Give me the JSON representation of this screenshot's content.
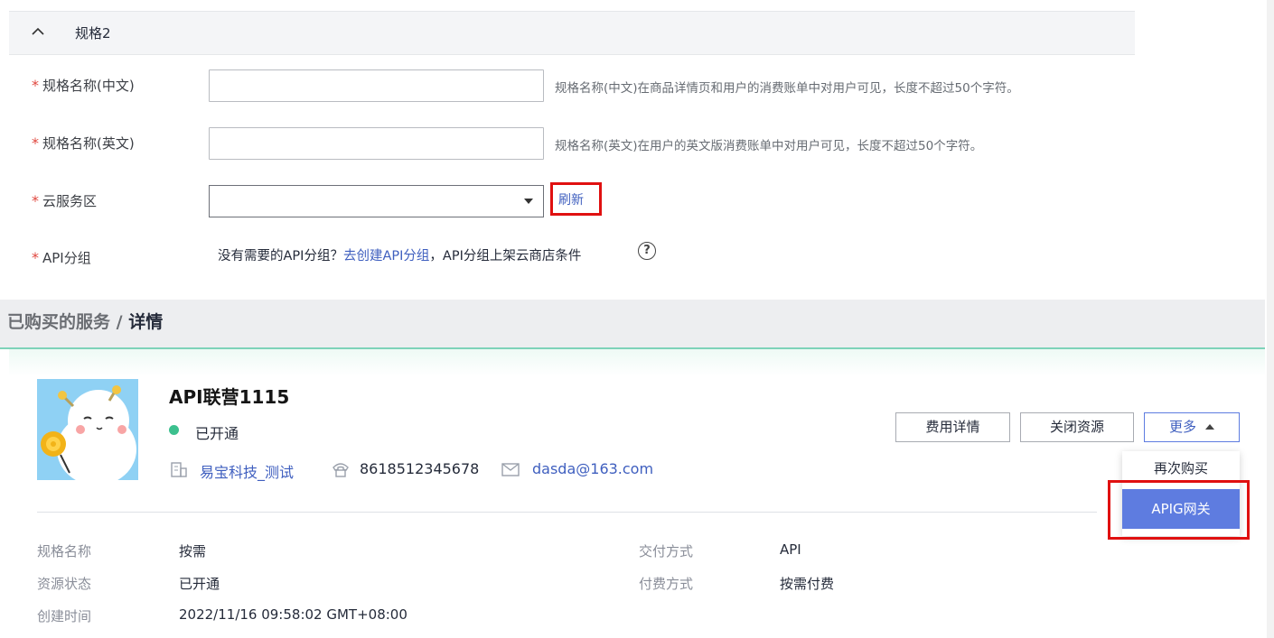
{
  "spec_section": {
    "title": "规格2",
    "fields": [
      {
        "label": "规格名称(中文)",
        "value": "",
        "hint": "规格名称(中文)在商品详情页和用户的消费账单中对用户可见，长度不超过50个字符。"
      },
      {
        "label": "规格名称(英文)",
        "value": "",
        "hint": "规格名称(英文)在用户的英文版消费账单中对用户可见，长度不超过50个字符。"
      }
    ],
    "region": {
      "label": "云服务区",
      "value": "",
      "refresh": "刷新"
    },
    "api_group": {
      "label": "API分组",
      "text_before": "没有需要的API分组？",
      "link": "去创建API分组",
      "text_after": "，API分组上架云商店条件",
      "help": "?"
    },
    "required_mark": "*"
  },
  "detail": {
    "breadcrumb_parent": "已购买的服务",
    "breadcrumb_sep": " / ",
    "breadcrumb_current": "详情",
    "service_name": "API联营1115",
    "status": "已开通",
    "company": "易宝科技_测试",
    "phone": "8618512345678",
    "email": "dasda@163.com",
    "buttons": {
      "fee_details": "费用详情",
      "close_resource": "关闭资源",
      "more": "更多"
    },
    "more_menu": [
      "再次购买",
      "APIG网关"
    ],
    "info": {
      "spec_name_label": "规格名称",
      "spec_name": "按需",
      "resource_status_label": "资源状态",
      "resource_status": "已开通",
      "created_label": "创建时间",
      "created": "2022/11/16 09:58:02 GMT+08:00",
      "delivery_label": "交付方式",
      "delivery": "API",
      "billing_label": "付费方式",
      "billing": "按需付费"
    }
  },
  "colors": {
    "link": "#3f5fbf",
    "primary": "#5e7ce0",
    "highlight": "#e01010",
    "status_ok": "#3cc08e",
    "required": "#e0473e"
  },
  "icons": [
    "chevron-up-icon",
    "dropdown-caret-icon",
    "help-circle-icon",
    "building-icon",
    "phone-icon",
    "mail-icon",
    "caret-up-icon"
  ]
}
